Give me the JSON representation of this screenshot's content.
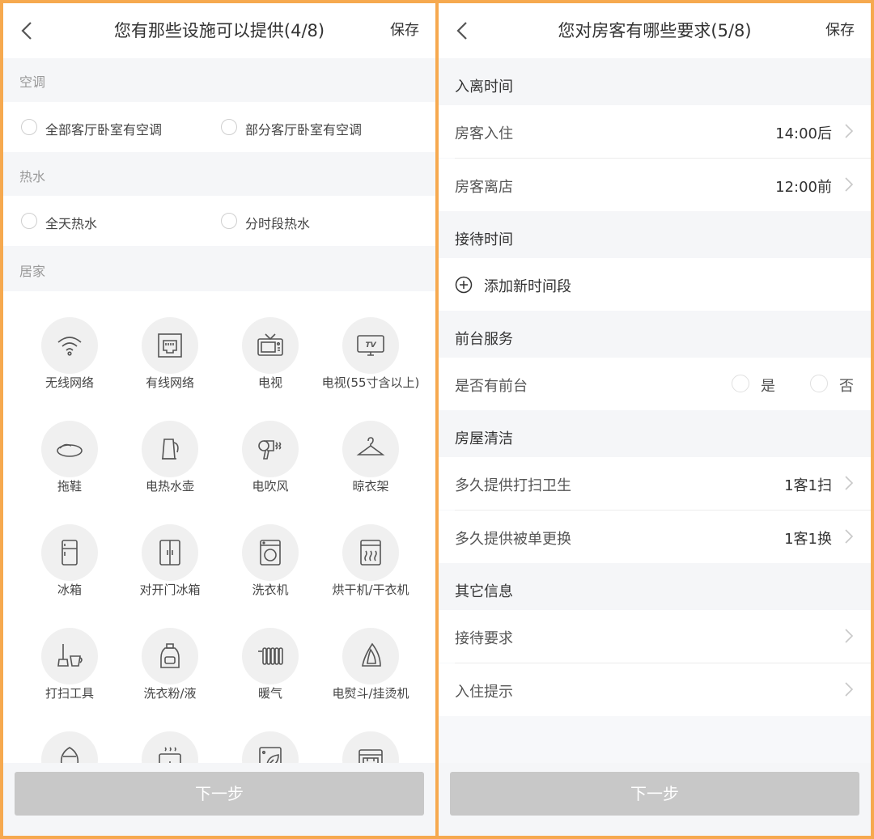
{
  "left": {
    "title": "您有那些设施可以提供(4/8)",
    "save": "保存",
    "sections": {
      "ac": {
        "title": "空调",
        "options": [
          "全部客厅卧室有空调",
          "部分客厅卧室有空调"
        ]
      },
      "hot_water": {
        "title": "热水",
        "options": [
          "全天热水",
          "分时段热水"
        ]
      },
      "home": {
        "title": "居家"
      }
    },
    "items": [
      {
        "label": "无线网络",
        "icon": "wifi-icon"
      },
      {
        "label": "有线网络",
        "icon": "ethernet-icon"
      },
      {
        "label": "电视",
        "icon": "tv-icon"
      },
      {
        "label": "电视(55寸含以上)",
        "icon": "large-tv-icon"
      },
      {
        "label": "拖鞋",
        "icon": "slippers-icon"
      },
      {
        "label": "电热水壶",
        "icon": "kettle-icon"
      },
      {
        "label": "电吹风",
        "icon": "hair-dryer-icon"
      },
      {
        "label": "晾衣架",
        "icon": "hanger-icon"
      },
      {
        "label": "冰箱",
        "icon": "fridge-icon"
      },
      {
        "label": "对开门冰箱",
        "icon": "double-door-fridge-icon"
      },
      {
        "label": "洗衣机",
        "icon": "washing-machine-icon"
      },
      {
        "label": "烘干机/干衣机",
        "icon": "dryer-icon"
      },
      {
        "label": "打扫工具",
        "icon": "cleaning-tools-icon"
      },
      {
        "label": "洗衣粉/液",
        "icon": "detergent-icon"
      },
      {
        "label": "暖气",
        "icon": "radiator-icon"
      },
      {
        "label": "电熨斗/挂烫机",
        "icon": "iron-icon"
      },
      {
        "label": "",
        "icon": "humidifier-icon"
      },
      {
        "label": "",
        "icon": "rice-cooker-icon"
      },
      {
        "label": "",
        "icon": "air-purifier-icon"
      },
      {
        "label": "",
        "icon": "oven-icon"
      }
    ],
    "next": "下一步"
  },
  "right": {
    "title": "您对房客有哪些要求(5/8)",
    "save": "保存",
    "checkin_section": "入离时间",
    "checkin_label": "房客入住",
    "checkin_value": "14:00后",
    "checkout_label": "房客离店",
    "checkout_value": "12:00前",
    "reception_section": "接待时间",
    "add_time": "添加新时间段",
    "front_desk_section": "前台服务",
    "front_desk_label": "是否有前台",
    "yes": "是",
    "no": "否",
    "cleaning_section": "房屋清洁",
    "cleaning_label": "多久提供打扫卫生",
    "cleaning_value": "1客1扫",
    "linen_label": "多久提供被单更换",
    "linen_value": "1客1换",
    "other_section": "其它信息",
    "reception_req": "接待要求",
    "checkin_tips": "入住提示",
    "next": "下一步"
  }
}
